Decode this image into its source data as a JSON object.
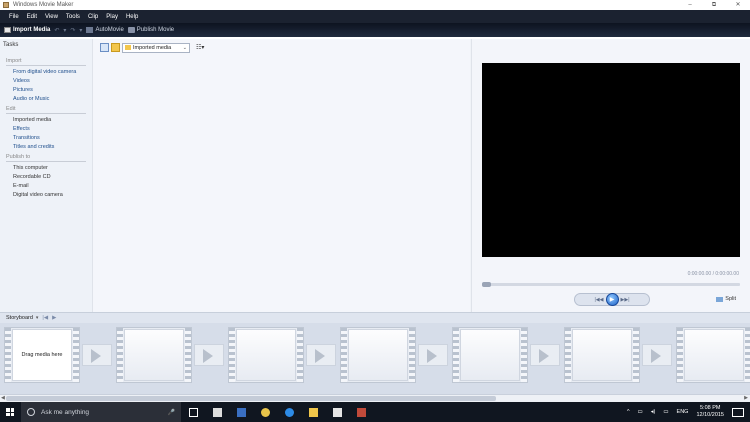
{
  "window": {
    "title": "Windows Movie Maker",
    "buttons": [
      "–",
      "⧉",
      "✕"
    ]
  },
  "menu": [
    "File",
    "Edit",
    "View",
    "Tools",
    "Clip",
    "Play",
    "Help"
  ],
  "toolbar": {
    "import_label": "Import Media",
    "undo": "↶",
    "redo": "↷",
    "dropdown": "▾",
    "automovie_label": "AutoMovie",
    "publish_label": "Publish Movie"
  },
  "tasks": {
    "header": "Tasks",
    "sections": [
      {
        "title": "Import",
        "links": [
          "From digital video camera",
          "Videos",
          "Pictures",
          "Audio or Music"
        ]
      },
      {
        "title": "Edit",
        "links": [
          "Imported media",
          "Effects",
          "Transitions",
          "Titles and credits"
        ]
      },
      {
        "title": "Publish to",
        "links": [
          "This computer",
          "Recordable CD",
          "E-mail",
          "Digital video camera"
        ]
      }
    ]
  },
  "collection": {
    "selected": "Imported media",
    "caret": "⌄",
    "view_icon": "☷▾"
  },
  "monitor": {
    "time": "0:00:00.00 / 0:00:00.00",
    "prev": "|◀◀",
    "play": "▶",
    "next": "▶▶|",
    "split_label": "Split"
  },
  "storyboard": {
    "label": "Storyboard",
    "caret": "▾",
    "rewind": "|◀",
    "play": "▶",
    "drag_text": "Drag media here",
    "frame_count": 7
  },
  "hscroll": {
    "left": "◀",
    "right": "▶"
  },
  "taskbar": {
    "search_placeholder": "Ask me anything",
    "mic": "🎤",
    "tray": {
      "arrow": "^",
      "lang": "ENG",
      "time": "5:08 PM",
      "date": "12/10/2015"
    }
  },
  "colors": {
    "menubar": "#1b2230",
    "taskbar": "#101620",
    "link": "#1e4e8c",
    "video": "#000000",
    "play": "#1f63c6"
  }
}
